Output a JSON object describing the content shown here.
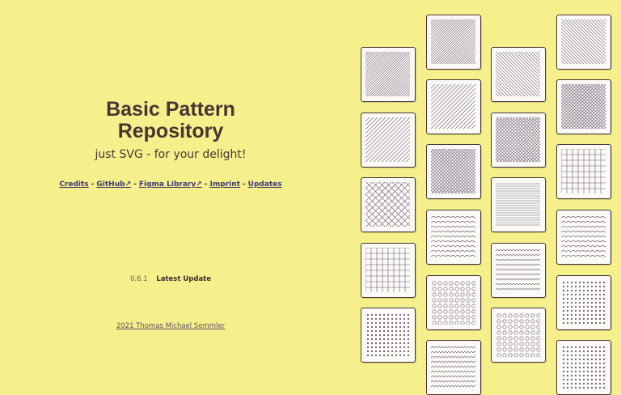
{
  "site": {
    "title_line1": "Basic Pattern",
    "title_line2": "Repository",
    "subtitle": "just SVG - for your delight!"
  },
  "nav": {
    "links": [
      {
        "label": "Credits"
      },
      {
        "label": "GitHub↗"
      },
      {
        "label": "Figma Library↗"
      },
      {
        "label": "Imprint"
      },
      {
        "label": "Updates"
      }
    ],
    "separator": "-"
  },
  "version": {
    "number": "0.6.1",
    "latest_update_label": "Latest Update"
  },
  "footer": {
    "credit": "2021 Thomas Michael Semmler"
  },
  "colors": {
    "background": "#f6f08c",
    "text": "#4a3433",
    "link": "#3b3a7a",
    "tile_bg": "#fbfaf6",
    "pattern_stroke": "#6a5a72"
  },
  "pattern_names": [
    "diagonal-lines-tight",
    "diagonal-lines-wide",
    "crosshatch-diagonal",
    "grid",
    "dots",
    "horizontal-lines",
    "diagonal-lines-reverse",
    "crosshatch-fine",
    "wave-lines",
    "circles",
    "zigzag-lines"
  ]
}
